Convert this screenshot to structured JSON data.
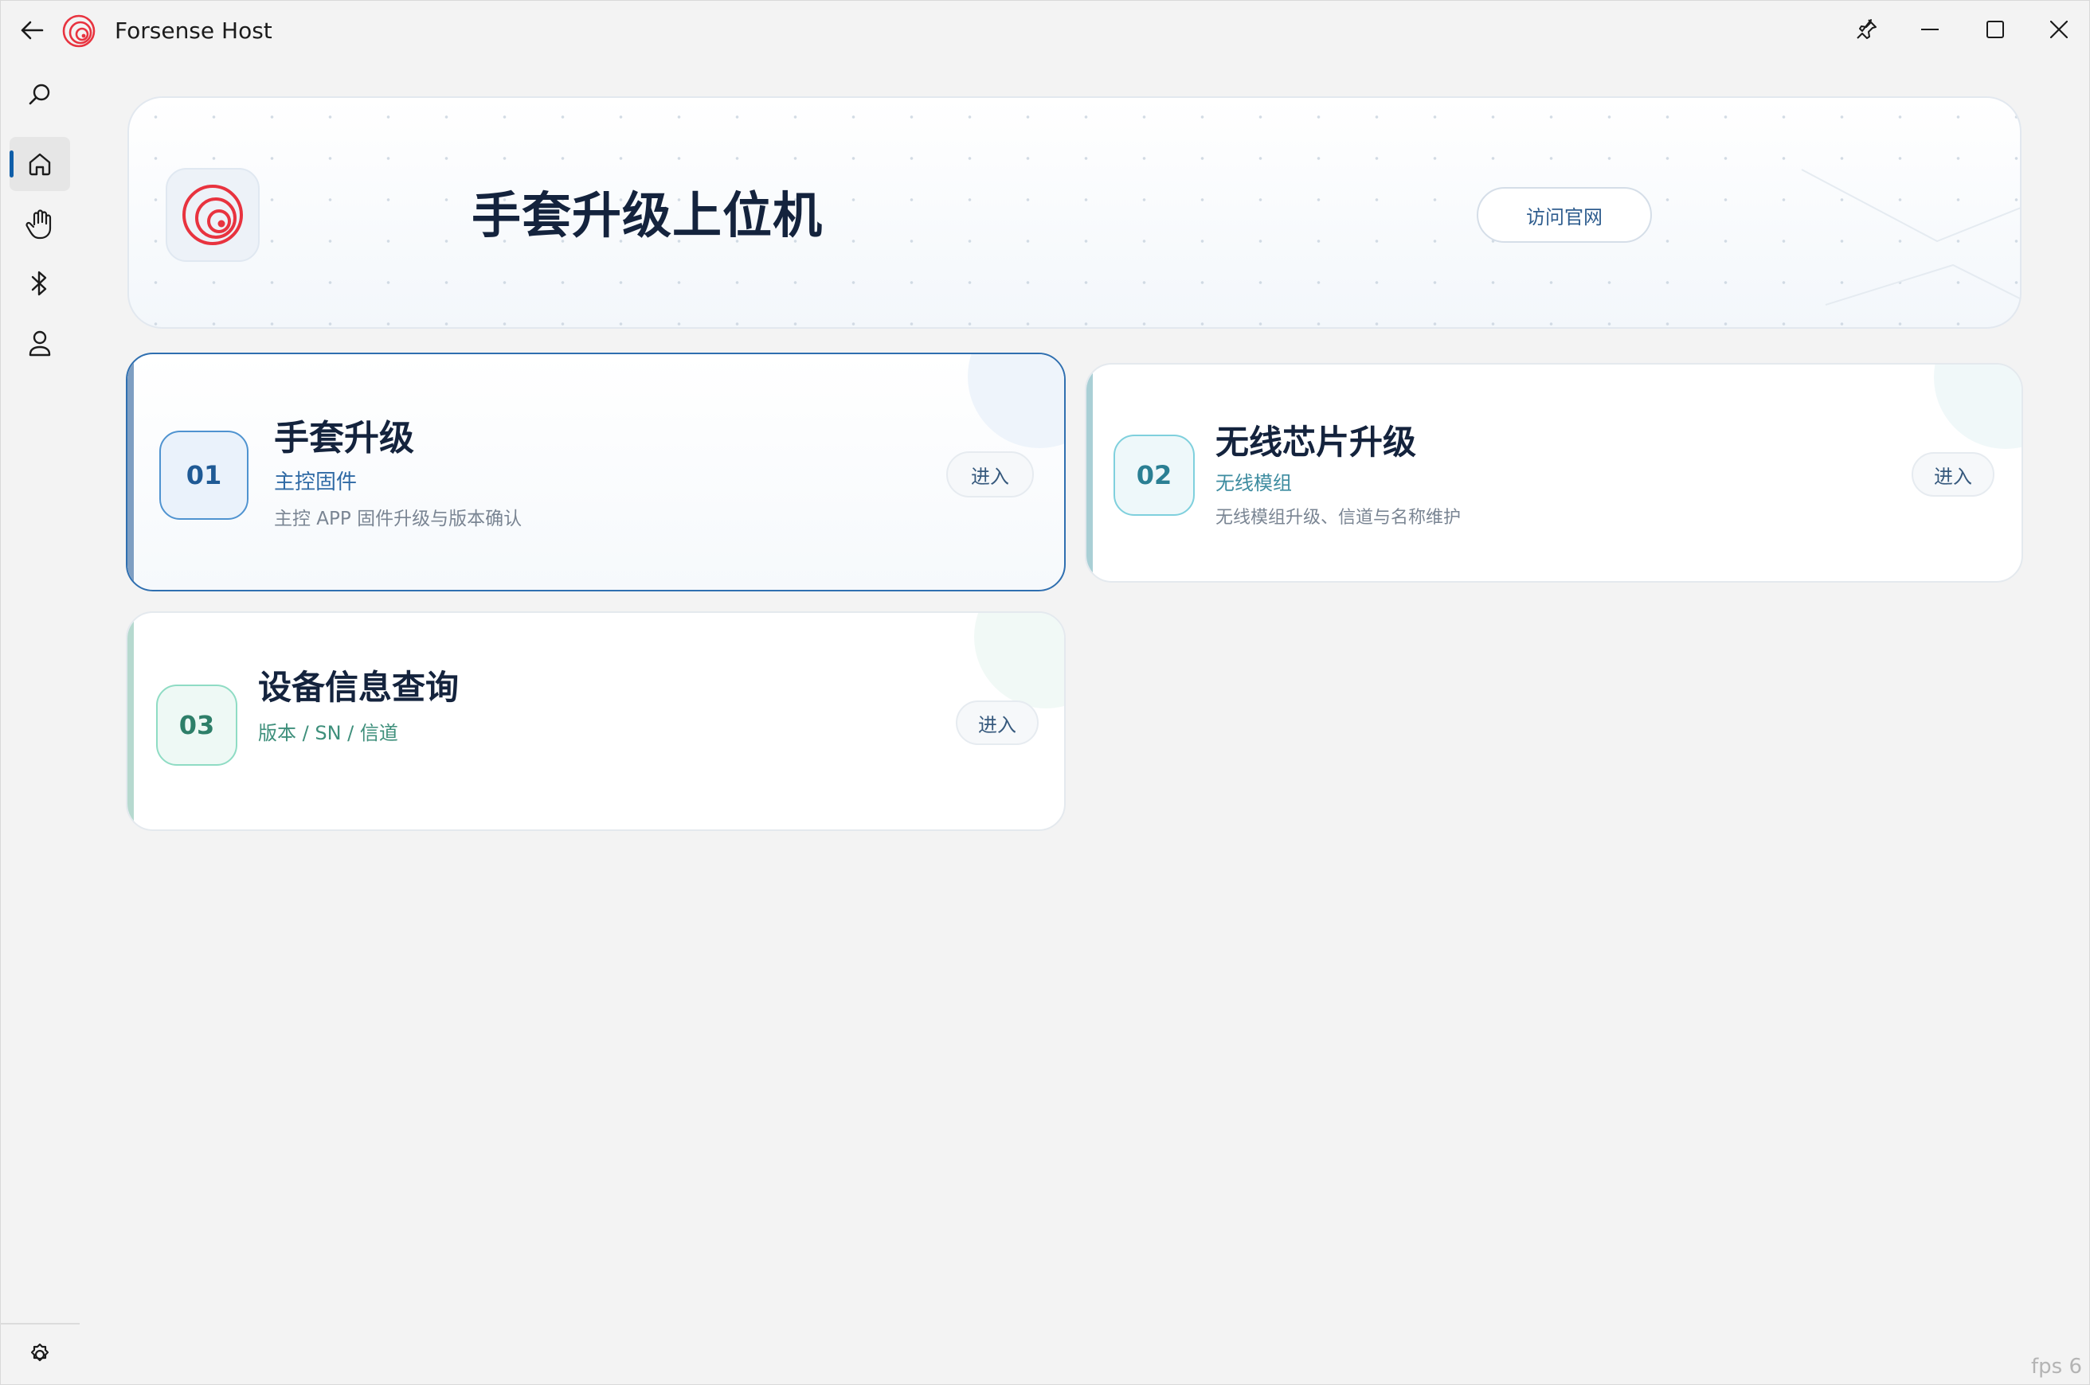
{
  "window": {
    "title": "Forsense Host"
  },
  "nav": {
    "items": [
      {
        "id": "search",
        "icon": "search-icon"
      },
      {
        "id": "home",
        "icon": "home-icon",
        "active": true
      },
      {
        "id": "glove",
        "icon": "hand-icon"
      },
      {
        "id": "bluetooth",
        "icon": "bluetooth-icon"
      },
      {
        "id": "user",
        "icon": "user-icon"
      }
    ],
    "settings_icon": "gear-icon"
  },
  "hero": {
    "title": "手套升级上位机",
    "visit_button": "访问官网"
  },
  "cards": [
    {
      "number": "01",
      "title": "手套升级",
      "subtitle": "主控固件",
      "description": "主控 APP 固件升级与版本确认",
      "action": "进入"
    },
    {
      "number": "02",
      "title": "无线芯片升级",
      "subtitle": "无线模组",
      "description": "无线模组升级、信道与名称维护",
      "action": "进入"
    },
    {
      "number": "03",
      "title": "设备信息查询",
      "subtitle": "版本 / SN / 信道",
      "action": "进入"
    }
  ],
  "status": {
    "fps": "fps 6"
  },
  "colors": {
    "accent": "#0f5ea8",
    "logo_red": "#e8333f",
    "card1_accent": "#2f6fb0",
    "card2_accent": "#58aabd",
    "card3_accent": "#5fb5a0"
  }
}
